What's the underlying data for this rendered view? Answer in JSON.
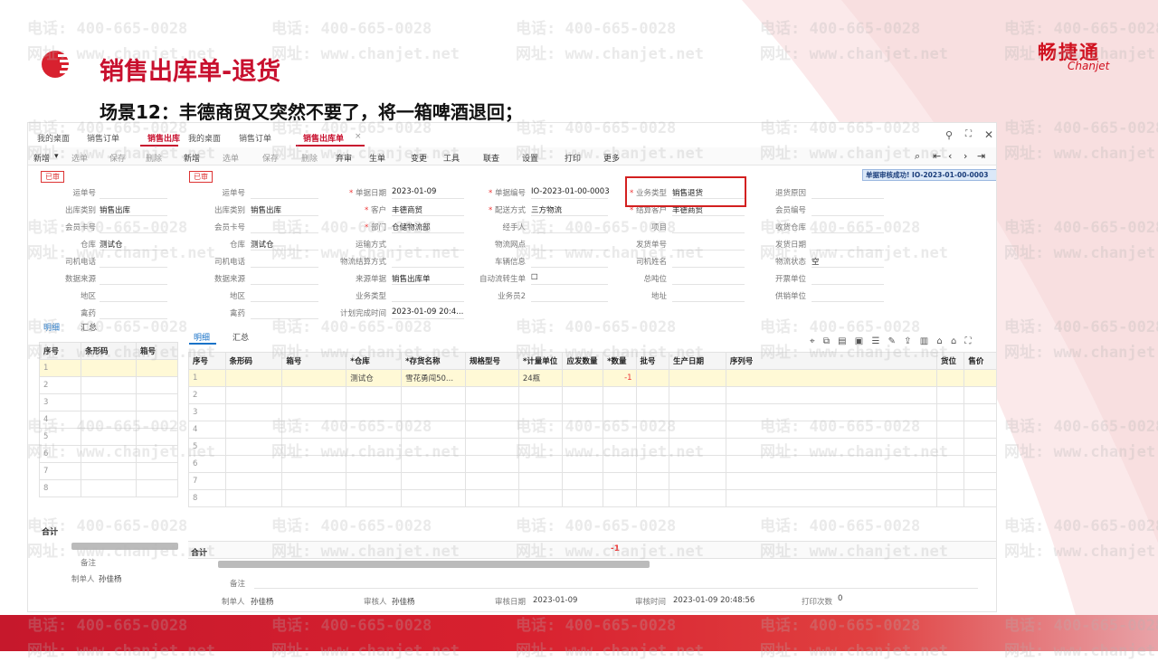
{
  "slide": {
    "title": "销售出库单-退货",
    "subtitle": "场景12：丰德商贸又突然不要了，将一箱啤酒退回；",
    "logo_cn": "畅捷通",
    "logo_en": "Chanjet",
    "watermark_phone": "电话: 400-665-0028",
    "watermark_url": "网址: www.chanjet.net",
    "accent": "#c8102e"
  },
  "window": {
    "tabs_outer": [
      "我的桌面",
      "销售订单",
      "销售出库"
    ],
    "tabs_inner": [
      "我的桌面",
      "销售订单",
      "销售出库单"
    ],
    "controls": [
      "search-icon",
      "maximize-icon",
      "close-icon"
    ]
  },
  "toolbar_left": [
    "新增",
    "选单",
    "保存",
    "删除"
  ],
  "toolbar_right": [
    "新增",
    "选单",
    "保存",
    "删除",
    "弃审",
    "生单",
    "变更",
    "工具",
    "联查",
    "设置",
    "打印",
    "更多"
  ],
  "status_stamp": "已审",
  "notice": "单据审核成功! IO-2023-01-00-0003",
  "left_form": {
    "labels": [
      "运单号",
      "出库类别",
      "会员卡号",
      "仓库",
      "司机电话",
      "数据来源",
      "地区",
      "禽药"
    ],
    "values": [
      "",
      "销售出库",
      "",
      "测试仓",
      "",
      "",
      "",
      ""
    ]
  },
  "form": {
    "col1": [
      {
        "label": "运单号",
        "value": ""
      },
      {
        "label": "出库类别",
        "value": "销售出库"
      },
      {
        "label": "会员卡号",
        "value": ""
      },
      {
        "label": "仓库",
        "value": "测试仓"
      },
      {
        "label": "司机电话",
        "value": ""
      },
      {
        "label": "数据来源",
        "value": ""
      },
      {
        "label": "地区",
        "value": ""
      },
      {
        "label": "禽药",
        "value": ""
      }
    ],
    "col2": [
      {
        "label": "单据日期",
        "value": "2023-01-09",
        "req": true
      },
      {
        "label": "客户",
        "value": "丰德商贸",
        "req": true
      },
      {
        "label": "部门",
        "value": "仓储物流部",
        "req": true
      },
      {
        "label": "运输方式",
        "value": ""
      },
      {
        "label": "物流结算方式",
        "value": ""
      },
      {
        "label": "来源单据",
        "value": "销售出库单"
      },
      {
        "label": "业务类型",
        "value": ""
      },
      {
        "label": "计划完成时间",
        "value": "2023-01-09 20:4..."
      }
    ],
    "col3": [
      {
        "label": "单据编号",
        "value": "IO-2023-01-00-0003",
        "req": true
      },
      {
        "label": "配送方式",
        "value": "三方物流",
        "req": true
      },
      {
        "label": "经手人",
        "value": ""
      },
      {
        "label": "物流网点",
        "value": ""
      },
      {
        "label": "车辆信息",
        "value": ""
      },
      {
        "label": "自动流转生单",
        "value": "☐"
      },
      {
        "label": "业务员2",
        "value": ""
      }
    ],
    "col4": [
      {
        "label": "业务类型",
        "value": "销售退货",
        "req": true
      },
      {
        "label": "结算客户",
        "value": "丰德商贸",
        "req": true
      },
      {
        "label": "项目",
        "value": ""
      },
      {
        "label": "发货单号",
        "value": ""
      },
      {
        "label": "司机姓名",
        "value": ""
      },
      {
        "label": "总吨位",
        "value": ""
      },
      {
        "label": "地址",
        "value": ""
      }
    ],
    "col5": [
      {
        "label": "退货原因",
        "value": ""
      },
      {
        "label": "会员编号",
        "value": ""
      },
      {
        "label": "收货仓库",
        "value": ""
      },
      {
        "label": "发货日期",
        "value": ""
      },
      {
        "label": "物流状态",
        "value": "空"
      },
      {
        "label": "开票单位",
        "value": ""
      },
      {
        "label": "供销单位",
        "value": ""
      }
    ]
  },
  "detail_tabs": [
    "明细",
    "汇总"
  ],
  "left_grid": {
    "headers": [
      "序号",
      "条形码",
      "箱号"
    ],
    "rows": [
      "1",
      "2",
      "3",
      "4",
      "5",
      "6",
      "7",
      "8"
    ]
  },
  "grid": {
    "headers": [
      "序号",
      "条形码",
      "箱号",
      "*仓库",
      "*存货名称",
      "规格型号",
      "*计量单位",
      "应发数量",
      "*数量",
      "批号",
      "生产日期",
      "序列号",
      "货位",
      "售价"
    ],
    "rows": [
      [
        "1",
        "",
        "",
        "测试仓",
        "雪花勇闯50...",
        "",
        "24瓶",
        "",
        "-1",
        "",
        "",
        "",
        "",
        ""
      ],
      [
        "2"
      ],
      [
        "3"
      ],
      [
        "4"
      ],
      [
        "5"
      ],
      [
        "6"
      ],
      [
        "7"
      ],
      [
        "8"
      ]
    ],
    "total_label": "合计",
    "total_qty": "-1"
  },
  "footer": {
    "remark_label": "备注",
    "maker_label": "制单人",
    "maker": "孙佳杨",
    "auditor_label": "审核人",
    "auditor": "孙佳杨",
    "audit_date_label": "审核日期",
    "audit_date": "2023-01-09",
    "audit_time_label": "审核时间",
    "audit_time": "2023-01-09 20:48:56",
    "print_label": "打印次数",
    "print_count": "0"
  }
}
